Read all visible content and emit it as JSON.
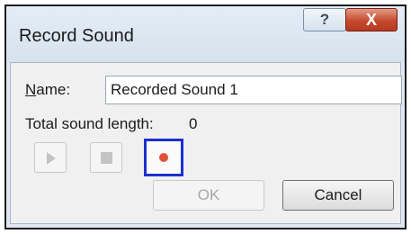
{
  "window": {
    "title": "Record Sound",
    "help_glyph": "?",
    "close_glyph": "X"
  },
  "form": {
    "name_label_accel": "N",
    "name_label_rest": "ame:",
    "name_value": "Recorded Sound 1",
    "length_label": "Total sound length:",
    "length_value": "0"
  },
  "controls": {
    "play_icon": "play-icon",
    "stop_icon": "stop-icon",
    "record_icon": "record-icon",
    "record_color": "#e0523a",
    "record_highlight": "#1d2fd0"
  },
  "buttons": {
    "ok_label": "OK",
    "cancel_label": "Cancel"
  }
}
